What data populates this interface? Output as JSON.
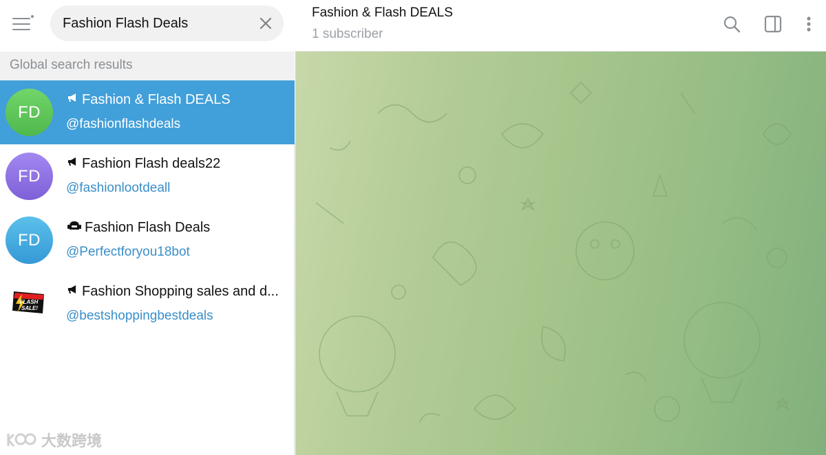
{
  "search": {
    "value": "Fashion Flash Deals",
    "clear_icon": "close-icon"
  },
  "sidebar": {
    "section_header": "Global search results",
    "results": [
      {
        "title": "Fashion & Flash DEALS",
        "handle": "@fashionflashdeals",
        "avatar_text": "FD",
        "type_icon": "megaphone-icon",
        "avatar_color": "#5cc85a"
      },
      {
        "title": "Fashion Flash deals22",
        "handle": "@fashionlootdeall",
        "avatar_text": "FD",
        "type_icon": "megaphone-icon",
        "avatar_color": "#8b6fe0"
      },
      {
        "title": "Fashion Flash Deals",
        "handle": "@Perfectforyou18bot",
        "avatar_text": "FD",
        "type_icon": "bot-icon",
        "avatar_color": "#3fa9dc"
      },
      {
        "title": "Fashion Shopping sales and d...",
        "handle": "@bestshoppingbestdeals",
        "avatar_text": "FLASH SALE!",
        "type_icon": "megaphone-icon"
      }
    ]
  },
  "chat": {
    "title": "Fashion & Flash DEALS",
    "subtitle": "1 subscriber"
  },
  "watermark": "大数跨境",
  "colors": {
    "accent": "#419fd9",
    "link": "#3a8fc8",
    "muted": "#8a8f94"
  }
}
